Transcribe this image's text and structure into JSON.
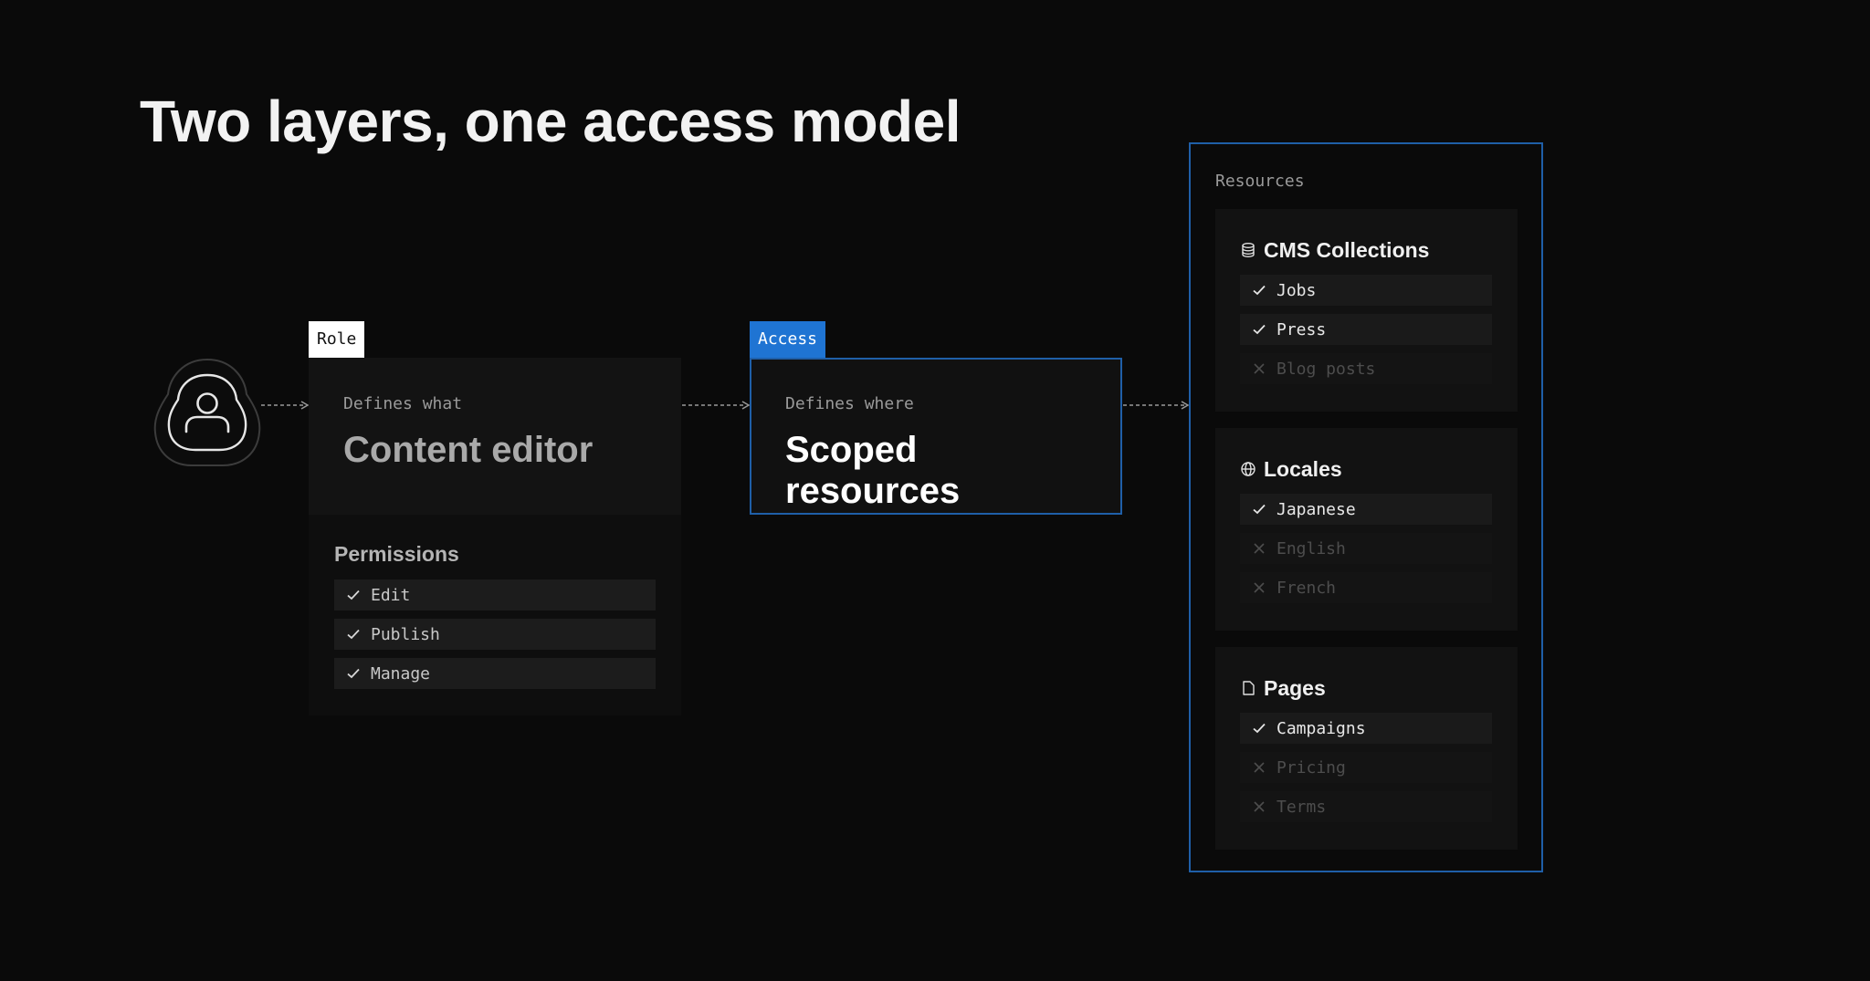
{
  "title": "Two layers, one access model",
  "role": {
    "tag": "Role",
    "kicker": "Defines what",
    "name": "Content editor",
    "permissions_title": "Permissions",
    "permissions": [
      "Edit",
      "Publish",
      "Manage"
    ]
  },
  "access": {
    "tag": "Access",
    "kicker": "Defines where",
    "name": "Scoped resources"
  },
  "resources": {
    "label": "Resources",
    "groups": [
      {
        "title": "CMS Collections",
        "icon": "database-icon",
        "items": [
          {
            "label": "Jobs",
            "enabled": true
          },
          {
            "label": "Press",
            "enabled": true
          },
          {
            "label": "Blog posts",
            "enabled": false
          }
        ]
      },
      {
        "title": "Locales",
        "icon": "globe-icon",
        "items": [
          {
            "label": "Japanese",
            "enabled": true
          },
          {
            "label": "English",
            "enabled": false
          },
          {
            "label": "French",
            "enabled": false
          }
        ]
      },
      {
        "title": "Pages",
        "icon": "page-icon",
        "items": [
          {
            "label": "Campaigns",
            "enabled": true
          },
          {
            "label": "Pricing",
            "enabled": false
          },
          {
            "label": "Terms",
            "enabled": false
          }
        ]
      }
    ]
  },
  "colors": {
    "background": "#0a0a0a",
    "accent": "#1f74d3",
    "card": "#121212"
  }
}
